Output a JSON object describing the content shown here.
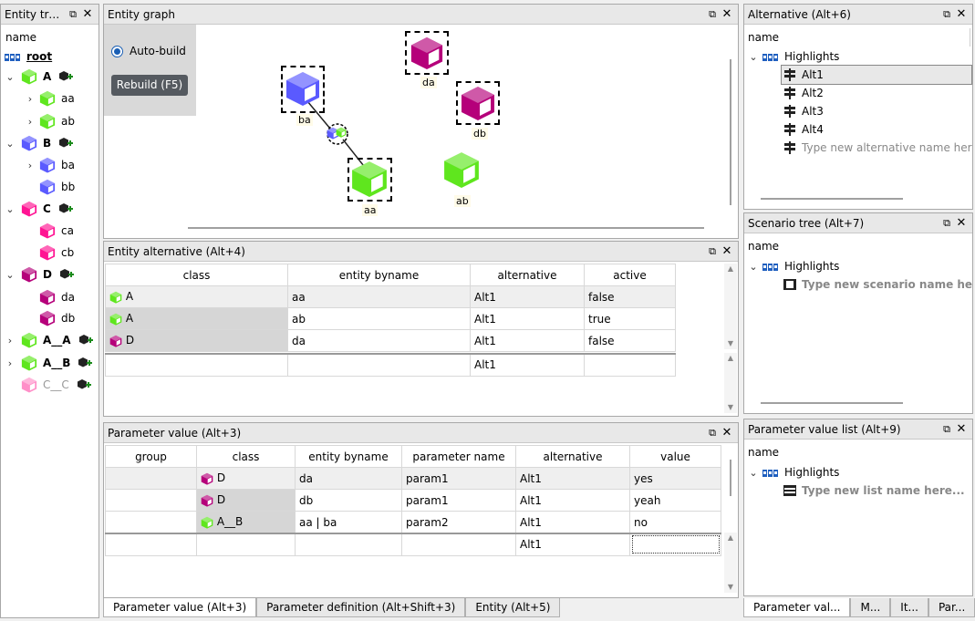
{
  "colors": {
    "green": "#5fe61e",
    "blue": "#5a5aff",
    "magenta": "#b5007a",
    "pink": "#ff1493",
    "purple": "#8e0f6e"
  },
  "entity_tree": {
    "title": "Entity tree ...",
    "header": "name",
    "root": "root",
    "items": [
      {
        "label": "A",
        "children": [
          "aa",
          "ab"
        ]
      },
      {
        "label": "B",
        "children": [
          "ba",
          "bb"
        ]
      },
      {
        "label": "C",
        "children": [
          "ca",
          "cb"
        ]
      },
      {
        "label": "D",
        "children": [
          "da",
          "db"
        ]
      },
      {
        "label": "A__A"
      },
      {
        "label": "A__B"
      },
      {
        "label": "C__C"
      }
    ]
  },
  "entity_graph": {
    "title": "Entity graph",
    "auto_build": "Auto-build",
    "rebuild": "Rebuild (F5)",
    "nodes": [
      "da",
      "ba",
      "db",
      "ab",
      "aa"
    ]
  },
  "entity_alternative": {
    "title": "Entity alternative (Alt+4)",
    "columns": [
      "class",
      "entity byname",
      "alternative",
      "active"
    ],
    "rows": [
      [
        "A",
        "aa",
        "Alt1",
        "false"
      ],
      [
        "A",
        "ab",
        "Alt1",
        "true"
      ],
      [
        "D",
        "da",
        "Alt1",
        "false"
      ]
    ],
    "new_row_alt": "Alt1"
  },
  "parameter_value": {
    "title": "Parameter value (Alt+3)",
    "columns": [
      "group",
      "class",
      "entity byname",
      "parameter name",
      "alternative",
      "value"
    ],
    "rows": [
      [
        "",
        "D",
        "da",
        "param1",
        "Alt1",
        "yes"
      ],
      [
        "",
        "D",
        "db",
        "param1",
        "Alt1",
        "yeah"
      ],
      [
        "",
        "A__B",
        "aa | ba",
        "param2",
        "Alt1",
        "no"
      ]
    ],
    "new_row_alt": "Alt1"
  },
  "bottom_tabs": [
    "Parameter value (Alt+3)",
    "Parameter definition (Alt+Shift+3)",
    "Entity (Alt+5)"
  ],
  "alternative": {
    "title": "Alternative (Alt+6)",
    "header": "name",
    "db": "Highlights",
    "items": [
      "Alt1",
      "Alt2",
      "Alt3",
      "Alt4"
    ],
    "placeholder": "Type new alternative name here..."
  },
  "scenario_tree": {
    "title": "Scenario tree (Alt+7)",
    "header": "name",
    "db": "Highlights",
    "placeholder": "Type new scenario name here..."
  },
  "parameter_value_list": {
    "title": "Parameter value list (Alt+9)",
    "header": "name",
    "db": "Highlights",
    "placeholder": "Type new list name here..."
  },
  "right_tabs": [
    "Parameter val...",
    "M...",
    "It...",
    "Par..."
  ]
}
